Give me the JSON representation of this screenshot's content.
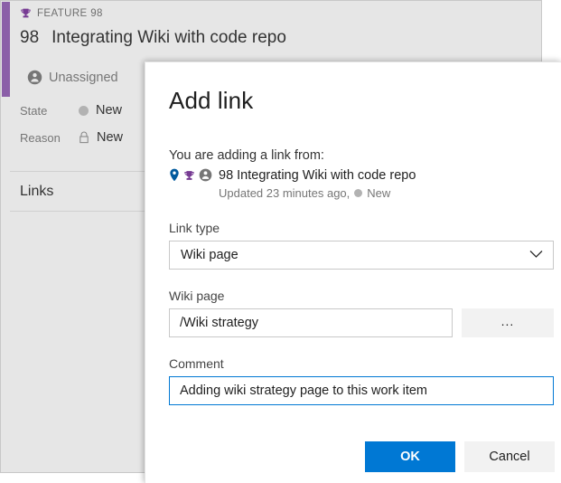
{
  "workitem": {
    "breadcrumb": "FEATURE 98",
    "breadcrumb_icon": "trophy-icon",
    "id": "98",
    "title": "Integrating Wiki with code repo",
    "assigned_to": "Unassigned",
    "assigned_icon": "person-badge-icon",
    "fields": [
      {
        "label": "State",
        "value": "New",
        "icon": "state-circle-icon"
      },
      {
        "label": "Reason",
        "value": "New",
        "icon": "lock-icon"
      }
    ],
    "links_section_heading": "Links",
    "accent_color": "#8b5fa8",
    "panel_bg": "#e6e6e6"
  },
  "dialog": {
    "title": "Add link",
    "adding_from_label": "You are adding a link from:",
    "source": {
      "icons": [
        "location-pin-icon",
        "trophy-icon",
        "person-badge-icon"
      ],
      "id": "98",
      "title": "Integrating Wiki with code repo",
      "full_title": "98 Integrating Wiki with code repo",
      "updated_text": "Updated 23 minutes ago,",
      "state": "New",
      "state_color": "#b2b2b2"
    },
    "link_type": {
      "label": "Link type",
      "value": "Wiki page",
      "chevron_icon": "chevron-down-icon",
      "options": [
        "Wiki page"
      ]
    },
    "wiki_page": {
      "label": "Wiki page",
      "value": "/Wiki strategy",
      "placeholder": "",
      "browse_label": "...",
      "browse_icon": "ellipsis-icon"
    },
    "comment": {
      "label": "Comment",
      "value": "Adding wiki strategy page to this work item",
      "placeholder": "",
      "focus_color": "#0078d4"
    },
    "buttons": {
      "ok": "OK",
      "cancel": "Cancel",
      "ok_color": "#0078d4",
      "cancel_color": "#f2f2f2"
    }
  }
}
